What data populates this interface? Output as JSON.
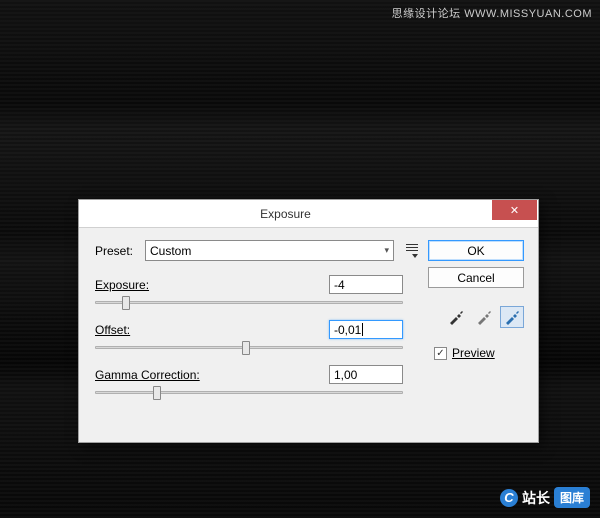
{
  "watermark_top": "思缘设计论坛  WWW.MISSYUAN.COM",
  "watermark_bottom": {
    "c": "C",
    "text1": "站长",
    "text2": "图库"
  },
  "dialog": {
    "title": "Exposure",
    "close_glyph": "✕",
    "preset_label": "Preset:",
    "preset_value": "Custom",
    "params": {
      "exposure": {
        "label": "Exposure:",
        "value": "-4",
        "thumb_pct": 10
      },
      "offset": {
        "label": "Offset:",
        "value": "-0,01",
        "thumb_pct": 49
      },
      "gamma": {
        "label": "Gamma Correction:",
        "value": "1,00",
        "thumb_pct": 20
      }
    },
    "buttons": {
      "ok": "OK",
      "cancel": "Cancel"
    },
    "preview": {
      "label": "Preview",
      "checked": true
    }
  }
}
